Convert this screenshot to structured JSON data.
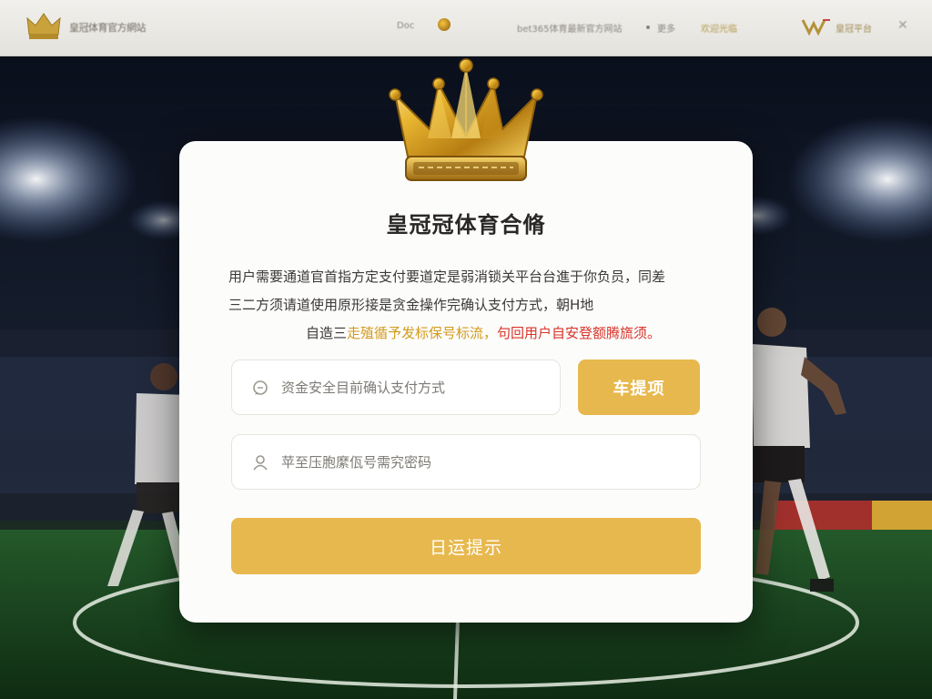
{
  "header": {
    "brand_text": "皇冠体育官方網站",
    "nav_items": [
      "Doc",
      "bet365体育最新官方网站",
      "更多",
      "欢迎光临"
    ],
    "right_text": "皇冠平台",
    "close_label": "✕"
  },
  "dialog": {
    "title": "皇冠冠体育合脩",
    "notice": {
      "line1": "用户需要通道官首指方定支付要道定是弱消锁关平台台進于你负员，同差",
      "line2": "三二方须请道使用原形接是贪金操作完确认支付方式，朝H地",
      "line3_prefix": "自造三",
      "line3_warn_a": "走殖循予发标保号标流，",
      "line3_warn_b": "句回用户自安登额腾旒须。"
    },
    "account_field": {
      "placeholder": "资金安全目前确认支付方式",
      "icon": "chat-bubble-icon"
    },
    "verify_button": {
      "label": "车提项"
    },
    "password_field": {
      "placeholder": "苹至压胞縻佤号需究密码",
      "icon": "user-icon"
    },
    "submit_button": {
      "label": "日运提示"
    }
  },
  "colors": {
    "accent": "#e7b84d",
    "warn_orange": "#d39a1c",
    "warn_red": "#d8342a",
    "card_bg": "#fcfcfb"
  }
}
